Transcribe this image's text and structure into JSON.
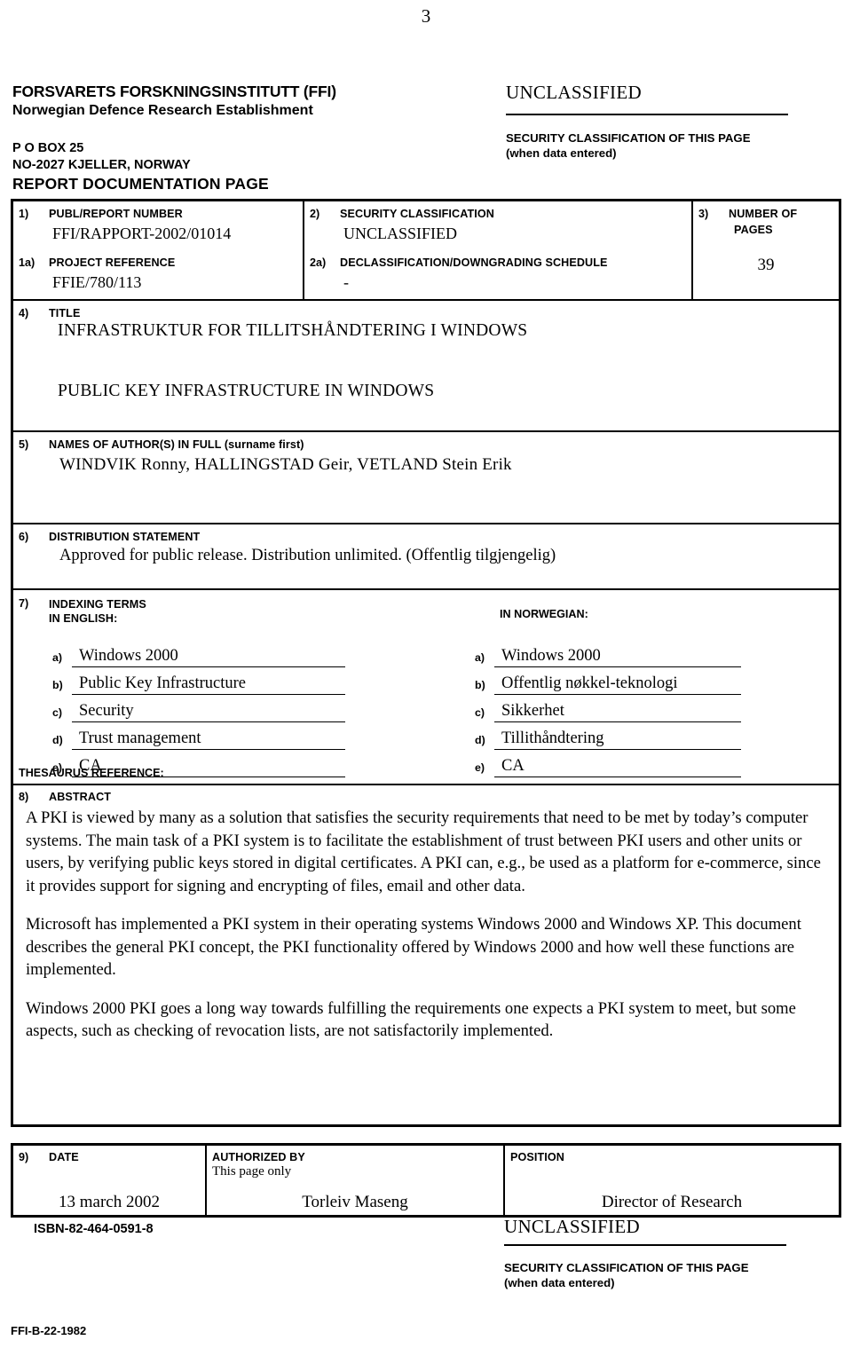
{
  "page_number": "3",
  "masthead": {
    "org_name_no": "FORSVARETS FORSKNINGSINSTITUTT (FFI)",
    "org_name_en": "Norwegian Defence Research Establishment",
    "address_line1": "P O BOX 25",
    "address_line2": "NO-2027 KJELLER, NORWAY",
    "form_title": "REPORT DOCUMENTATION PAGE",
    "classification": "UNCLASSIFIED",
    "caption_line1": "SECURITY CLASSIFICATION OF THIS PAGE",
    "caption_line2": "(when data entered)"
  },
  "fields": {
    "f1": {
      "num": "1)",
      "label": "PUBL/REPORT NUMBER",
      "value": "FFI/RAPPORT-2002/01014"
    },
    "f1a": {
      "num": "1a)",
      "label": "PROJECT REFERENCE",
      "value": "FFIE/780/113"
    },
    "f2": {
      "num": "2)",
      "label": "SECURITY CLASSIFICATION",
      "value": "UNCLASSIFIED"
    },
    "f2a": {
      "num": "2a)",
      "label": "DECLASSIFICATION/DOWNGRADING SCHEDULE",
      "value": "-"
    },
    "f3": {
      "num": "3)",
      "label_line1": "NUMBER OF",
      "label_line2": "PAGES",
      "value": "39"
    },
    "f4": {
      "num": "4)",
      "label": "TITLE",
      "title_no": "INFRASTRUKTUR FOR TILLITSHÅNDTERING I WINDOWS",
      "title_en": "PUBLIC KEY INFRASTRUCTURE IN WINDOWS"
    },
    "f5": {
      "num": "5)",
      "label": "NAMES OF AUTHOR(S) IN FULL (surname first)",
      "value": "WINDVIK Ronny, HALLINGSTAD Geir, VETLAND Stein Erik"
    },
    "f6": {
      "num": "6)",
      "label": "DISTRIBUTION STATEMENT",
      "value": "Approved for public release. Distribution unlimited.  (Offentlig tilgjengelig)"
    },
    "f7": {
      "num": "7)",
      "label_line1": "INDEXING TERMS",
      "label_line2": "IN ENGLISH:",
      "label_norwegian": "IN NORWEGIAN:",
      "thesaurus_label": "THESAURUS REFERENCE:",
      "letters": [
        "a)",
        "b)",
        "c)",
        "d)",
        "e)"
      ],
      "english": [
        "Windows 2000",
        "Public Key Infrastructure",
        "Security",
        "Trust management",
        "CA"
      ],
      "norwegian": [
        "Windows 2000",
        "Offentlig nøkkel-teknologi",
        "Sikkerhet",
        "Tillithåndtering",
        "CA"
      ]
    },
    "f8": {
      "num": "8)",
      "label": "ABSTRACT",
      "paragraphs": [
        "A PKI is viewed by many as a solution that satisfies the security requirements that need to be met by today’s computer systems. The main task of a PKI system is to facilitate the establishment of trust between PKI users and other units or users, by verifying public keys stored in digital certificates. A PKI can, e.g., be used as a platform for e-commerce, since it provides support for signing and encrypting of files, email and other data.",
        "Microsoft has implemented a PKI system in their operating systems Windows 2000 and Windows XP. This document describes the general PKI concept, the PKI functionality offered by Windows 2000 and how well these functions are implemented.",
        "Windows 2000 PKI goes a long way towards fulfilling the requirements one expects a PKI system to meet, but some aspects, such as checking of revocation lists, are not satisfactorily implemented."
      ]
    },
    "f9": {
      "num": "9)",
      "label": "DATE",
      "value": "13 march 2002"
    },
    "authorized": {
      "label": "AUTHORIZED BY",
      "sublabel": "This page only",
      "value": "Torleiv Maseng"
    },
    "position": {
      "label": "POSITION",
      "value": "Director of Research"
    }
  },
  "footer": {
    "isbn": "ISBN-82-464-0591-8",
    "classification": "UNCLASSIFIED",
    "caption_line1": "SECURITY CLASSIFICATION OF THIS PAGE",
    "caption_line2": "(when data entered)",
    "form_code": "FFI-B-22-1982"
  }
}
